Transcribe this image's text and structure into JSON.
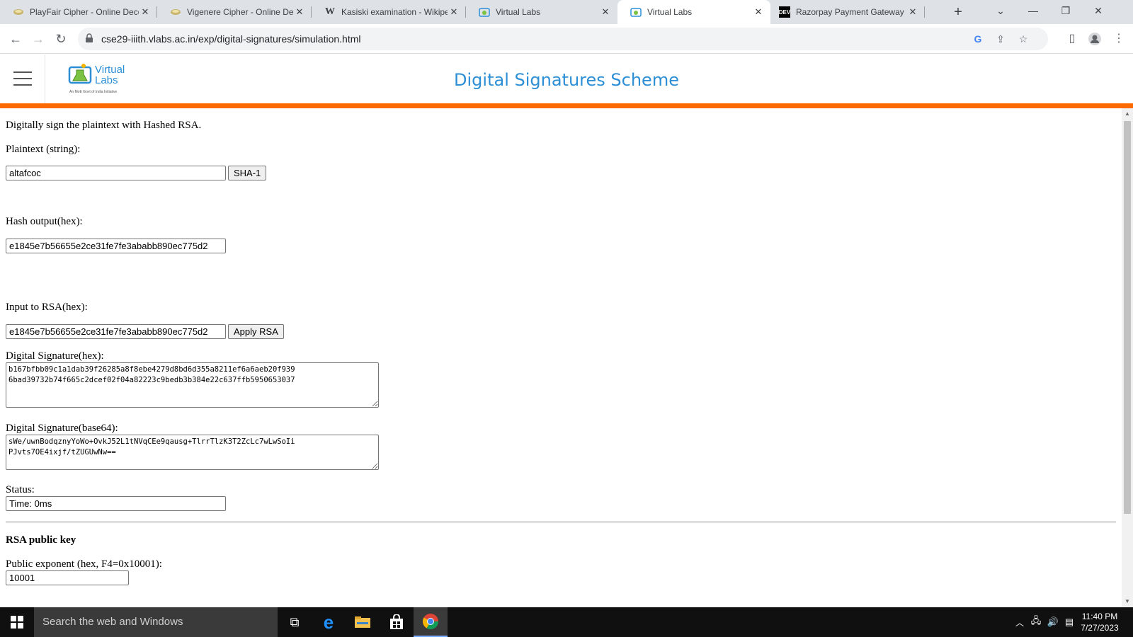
{
  "browser": {
    "tabs": [
      {
        "title": "PlayFair Cipher - Online Deco",
        "icon": "cipher-favicon"
      },
      {
        "title": "Vigenere Cipher - Online Dec",
        "icon": "cipher-favicon"
      },
      {
        "title": "Kasiski examination - Wikiped",
        "icon": "W"
      },
      {
        "title": "Virtual Labs",
        "icon": "vlabs-favicon"
      },
      {
        "title": "Virtual Labs",
        "icon": "vlabs-favicon",
        "active": true
      },
      {
        "title": "Razorpay Payment Gateway I",
        "icon": "DEV"
      }
    ],
    "url": "cse29-iiith.vlabs.ac.in/exp/digital-signatures/simulation.html"
  },
  "site": {
    "title": "Digital Signatures Scheme",
    "logo_text": "Virtual Labs",
    "logo_sub": "An MoE Govt of India Initiative"
  },
  "form": {
    "intro": "Digitally sign the plaintext with Hashed RSA.",
    "plaintext_label": "Plaintext (string):",
    "plaintext_value": "altafcoc",
    "sha_button": "SHA-1",
    "hash_label": "Hash output(hex):",
    "hash_value": "e1845e7b56655e2ce31fe7fe3ababb890ec775d2",
    "rsa_input_label": "Input to RSA(hex):",
    "rsa_input_value": "e1845e7b56655e2ce31fe7fe3ababb890ec775d2",
    "apply_button": "Apply RSA",
    "sig_hex_label": "Digital Signature(hex):",
    "sig_hex_value": "b167bfbb09c1a1dab39f26285a8f8ebe4279d8bd6d355a8211ef6a6aeb20f939\n6bad39732b74f665c2dcef02f04a82223c9bedb3b384e22c637ffb5950653037",
    "sig_b64_label": "Digital Signature(base64):",
    "sig_b64_value": "sWe/uwnBodqznyYoWo+OvkJ52L1tNVqCEe9qausg+TlrrTlzK3T2ZcLc7wLwSoIi\nPJvts7OE4ixjf/tZUGUwNw==",
    "status_label": "Status:",
    "status_value": "Time: 0ms",
    "pubkey_heading": "RSA public key",
    "pubexp_label": "Public exponent (hex, F4=0x10001):",
    "pubexp_value": "10001"
  },
  "taskbar": {
    "search_placeholder": "Search the web and Windows",
    "time": "11:40 PM",
    "date": "7/27/2023"
  },
  "colors": {
    "accent_orange": "#ff6a00",
    "title_blue": "#2c8fd6"
  }
}
